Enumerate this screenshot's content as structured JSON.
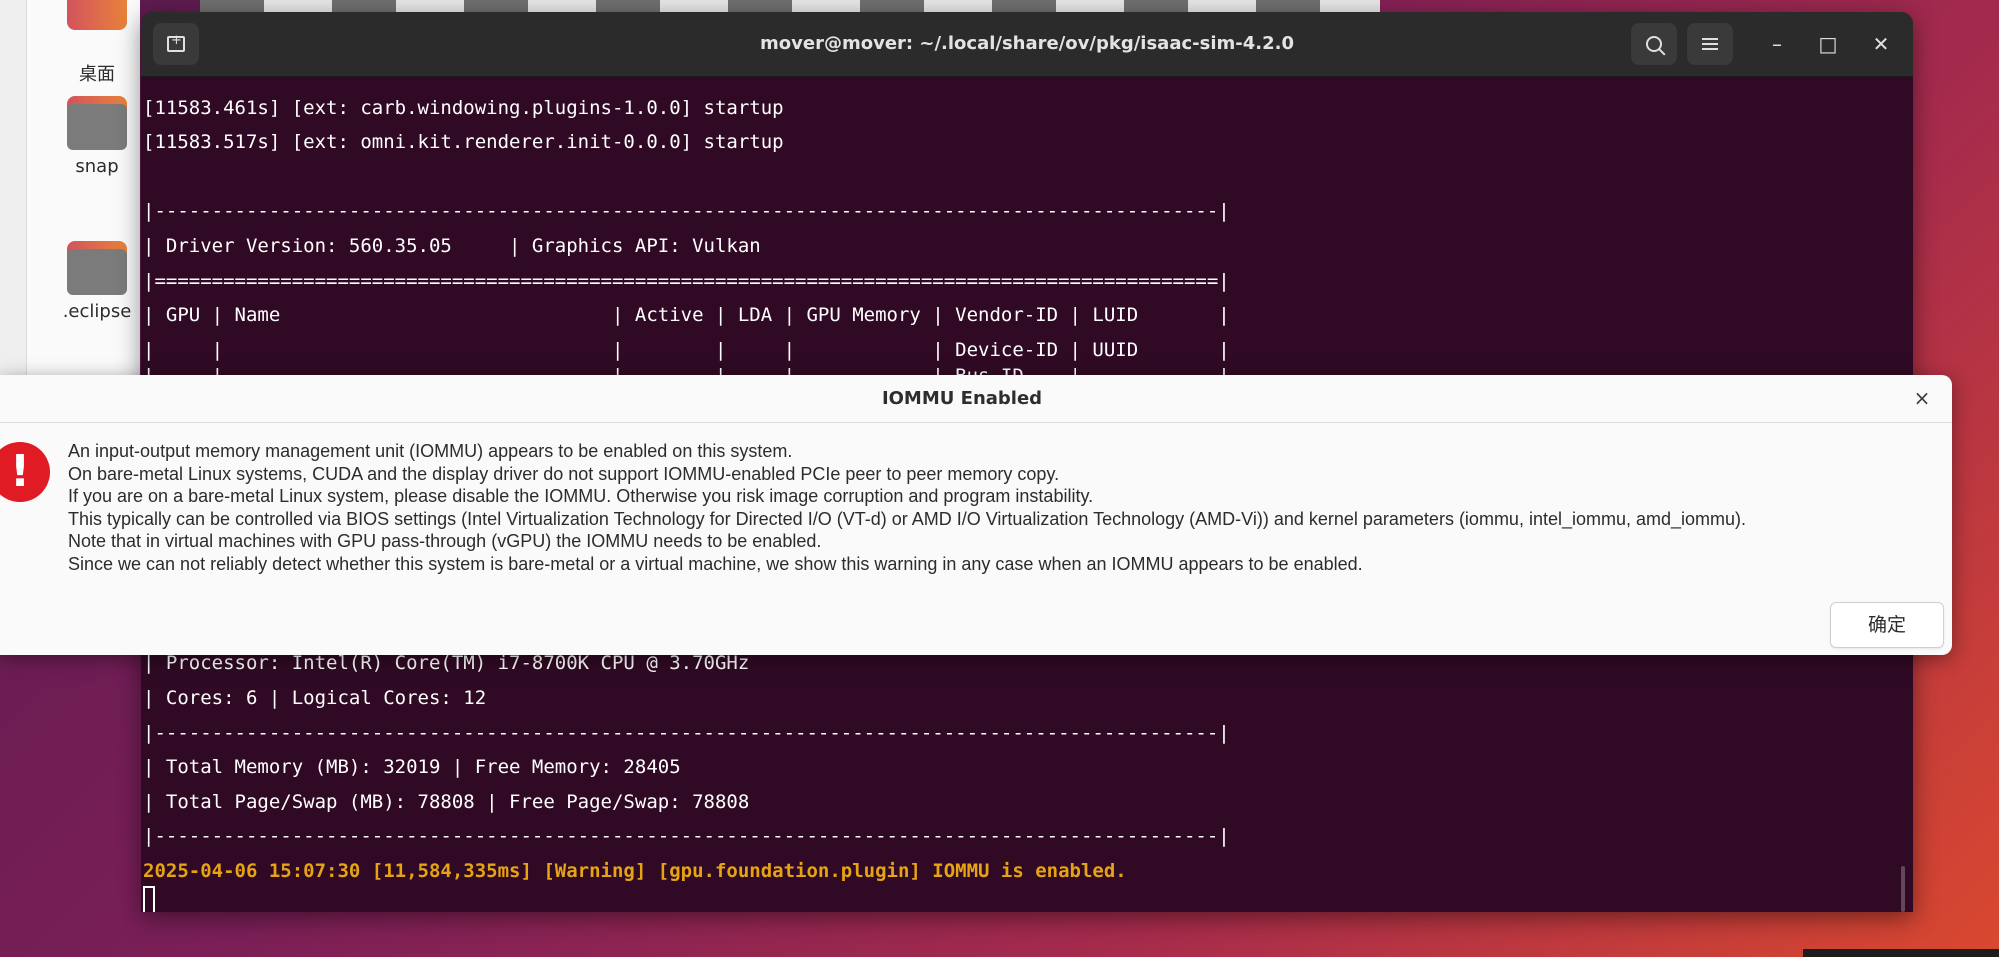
{
  "desktop": {
    "items": [
      {
        "label": "桌面"
      },
      {
        "label": "snap"
      },
      {
        "label": ".eclipse"
      }
    ]
  },
  "terminal": {
    "title": "mover@mover: ~/.local/share/ov/pkg/isaac-sim-4.2.0",
    "lines": [
      "[11583.461s] [ext: carb.windowing.plugins-1.0.0] startup",
      "[11583.517s] [ext: omni.kit.renderer.init-0.0.0] startup",
      "",
      "|---------------------------------------------------------------------------------------------|",
      "| Driver Version: 560.35.05     | Graphics API: Vulkan",
      "|=============================================================================================|",
      "| GPU | Name                             | Active | LDA | GPU Memory | Vendor-ID | LUID       |",
      "|     |                                  |        |     |            | Device-ID | UUID       |",
      "|     |                                  |        |     |            | Bus-ID    |            |",
      "| Processor: Intel(R) Core(TM) i7-8700K CPU @ 3.70GHz",
      "| Cores: 6 | Logical Cores: 12",
      "|---------------------------------------------------------------------------------------------|",
      "| Total Memory (MB): 32019 | Free Memory: 28405",
      "| Total Page/Swap (MB): 78808 | Free Page/Swap: 78808",
      "|---------------------------------------------------------------------------------------------|",
      "2025-04-06 15:07:30 [11,584,335ms] [Warning] [gpu.foundation.plugin] IOMMU is enabled."
    ]
  },
  "dialog": {
    "title": "IOMMU Enabled",
    "close": "×",
    "icon": "!",
    "lines": [
      "An input-output memory management unit (IOMMU) appears to be enabled on this system.",
      "On bare-metal Linux systems, CUDA and the display driver do not support IOMMU-enabled PCIe peer to peer memory copy.",
      "If you are on a bare-metal Linux system, please disable the IOMMU. Otherwise you risk image corruption and program instability.",
      "This typically can be controlled via BIOS settings (Intel Virtualization Technology for Directed I/O (VT-d) or AMD I/O Virtualization Technology (AMD-Vi)) and kernel parameters (iommu, intel_iommu, amd_iommu).",
      "Note that in virtual machines with GPU pass-through (vGPU) the IOMMU needs to be enabled.",
      "Since we can not reliably detect whether this system is bare-metal or a virtual machine, we show this warning in any case when an IOMMU appears to be enabled."
    ],
    "ok_label": "确定"
  },
  "icons": {
    "minimize": "–",
    "maximize": "□",
    "close": "✕"
  },
  "colors": {
    "terminal_bg": "#300a24",
    "warning": "#e6a313",
    "alert": "#e01b24"
  }
}
